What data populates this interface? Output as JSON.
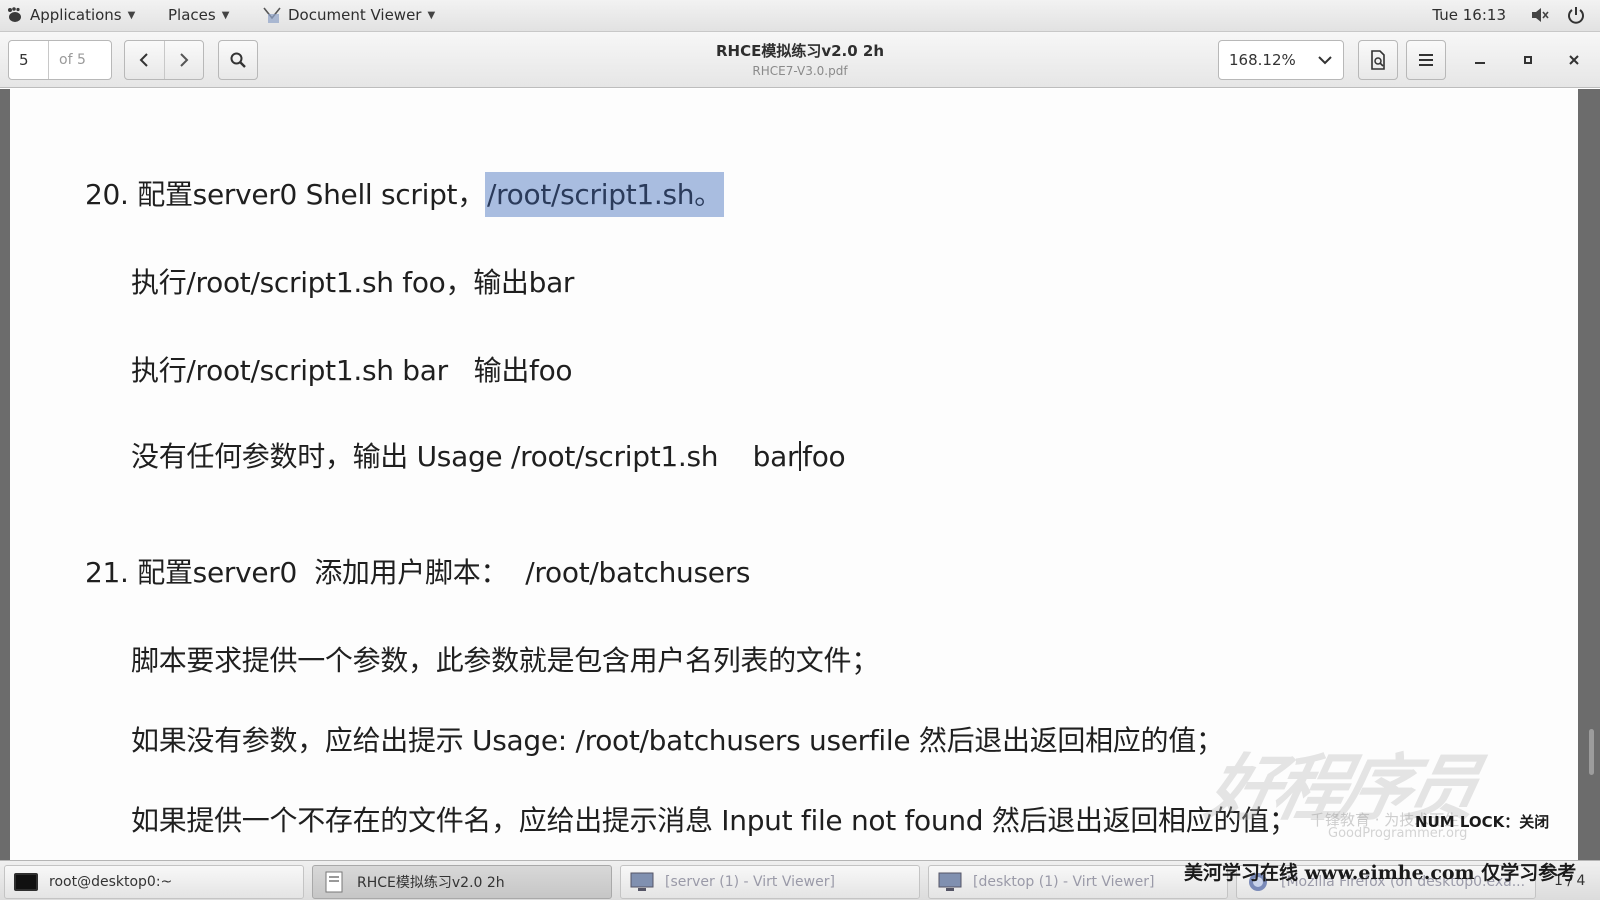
{
  "top_panel": {
    "applications": "Applications",
    "places": "Places",
    "app_name": "Document Viewer",
    "clock": "Tue 16:13"
  },
  "header": {
    "page_value": "5",
    "page_of": "of 5",
    "title": "RHCE模拟练习v2.0 2h",
    "subtitle": "RHCE7-V3.0.pdf",
    "zoom": "168.12%"
  },
  "document": {
    "q20_number": "20.",
    "q20_text": "配置server0 Shell script，",
    "q20_highlight": "/root/script1.sh。",
    "q20_line1": "执行/root/script1.sh foo，输出bar",
    "q20_line2": "执行/root/script1.sh bar   输出foo",
    "q20_line3_a": "没有任何参数时，输出 Usage /root/script1.sh    bar",
    "q20_line3_b": "foo",
    "q21_number": "21.",
    "q21_text": "配置server0  添加用户脚本：  /root/batchusers",
    "q21_line1": "脚本要求提供一个参数，此参数就是包含用户名列表的文件；",
    "q21_line2": "如果没有参数，应给出提示 Usage: /root/batchusers userfile 然后退出返回相应的值；",
    "q21_line3": "如果提供一个不存在的文件名，应给出提示消息 Input file not found 然后退出返回相应的值；"
  },
  "watermark": {
    "logo": "好程序员",
    "logo_sub": "千锋教育 · 为技术而生",
    "url": "GoodProgrammer.org",
    "numlock": "NUM LOCK：关闭",
    "bottom": "美河学习在线 www.eimhe.com 仅学习参考"
  },
  "taskbar": {
    "items": [
      {
        "label": "root@desktop0:~"
      },
      {
        "label": "RHCE模拟练习v2.0 2h"
      },
      {
        "label": "[server (1) - Virt Viewer]"
      },
      {
        "label": "[desktop (1) - Virt Viewer]"
      },
      {
        "label": "[Mozilla Firefox (on desktop0.exa..."
      }
    ],
    "workspace": "1 / 4"
  },
  "icons": {
    "apps": "gnome-foot-icon",
    "doc": "document-viewer-icon",
    "search": "search-icon",
    "prev": "chevron-left-icon",
    "next": "chevron-right-icon",
    "zoom_dropdown": "chevron-down-icon",
    "fit": "page-fit-icon",
    "menu": "hamburger-menu-icon",
    "volume": "volume-muted-icon",
    "power": "power-icon"
  },
  "colors": {
    "selection": "#a9bde0",
    "page_bg": "#fdfdfd",
    "panel_bg": "#e8e8e8"
  }
}
